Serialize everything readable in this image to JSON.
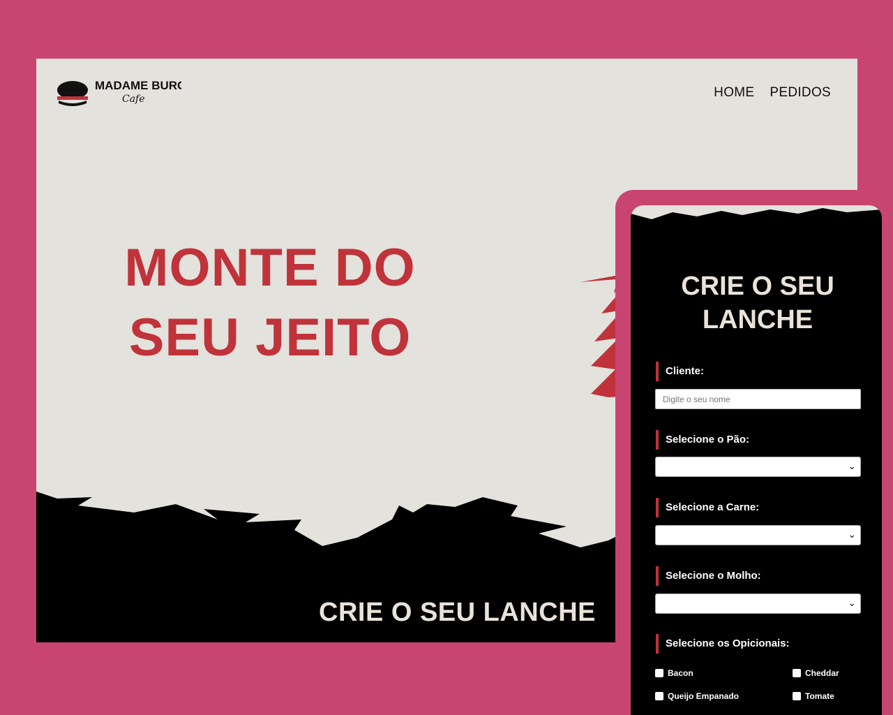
{
  "brand": {
    "name": "MADAME BURGER",
    "sub": "Cafe"
  },
  "nav": {
    "home": "HOME",
    "pedidos": "PEDIDOS"
  },
  "hero": {
    "line1": "MONTE DO",
    "line2": "SEU JEITO",
    "cta": "CRIE O SEU LANCHE"
  },
  "form": {
    "title_line1": "CRIE O SEU",
    "title_line2": "LANCHE",
    "cliente_label": "Cliente:",
    "cliente_placeholder": "Digite o seu nome",
    "pao_label": "Selecione o Pão:",
    "carne_label": "Selecione a Carne:",
    "molho_label": "Selecione o Molho:",
    "opcionais_label": "Selecione os Opicionais:",
    "opcionais": [
      "Bacon",
      "Cheddar",
      "Queijo Empanado",
      "Tomate"
    ]
  },
  "colors": {
    "background": "#c94571",
    "accent": "#c0333a",
    "paper": "#e4e2dd",
    "ink": "#000000"
  }
}
